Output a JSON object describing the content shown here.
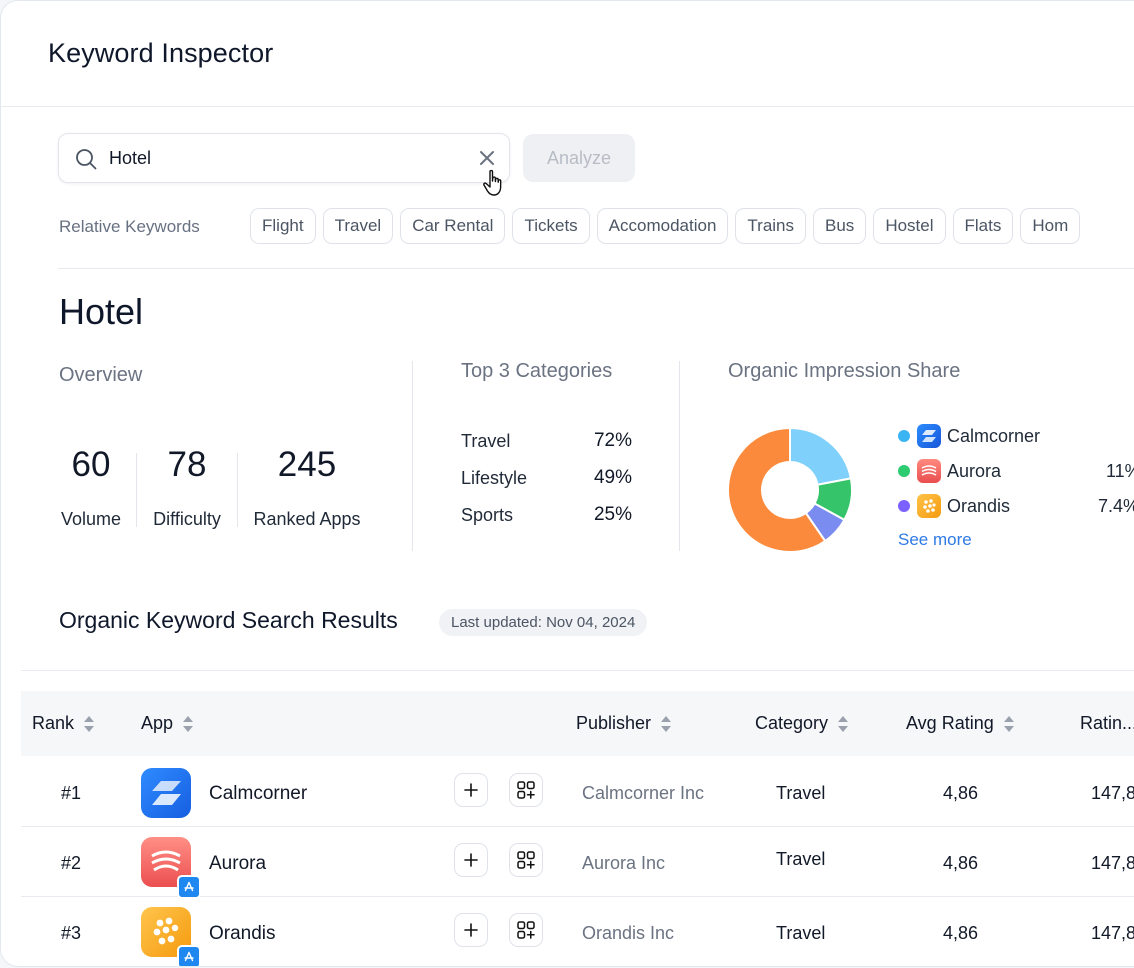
{
  "app": {
    "title": "Keyword Inspector"
  },
  "search": {
    "value": "Hotel",
    "analyze_label": "Analyze"
  },
  "relative_keywords": {
    "label": "Relative Keywords",
    "chips": [
      "Flight",
      "Travel",
      "Car Rental",
      "Tickets",
      "Accomodation",
      "Trains",
      "Bus",
      "Hostel",
      "Flats",
      "Hom"
    ]
  },
  "keyword": {
    "heading": "Hotel"
  },
  "overview": {
    "label": "Overview",
    "stats": [
      {
        "value": "60",
        "label": "Volume"
      },
      {
        "value": "78",
        "label": "Difficulty"
      },
      {
        "value": "245",
        "label": "Ranked Apps"
      }
    ]
  },
  "top_categories": {
    "label": "Top 3 Categories",
    "items": [
      {
        "name": "Travel",
        "value": "72%"
      },
      {
        "name": "Lifestyle",
        "value": "49%"
      },
      {
        "name": "Sports",
        "value": "25%"
      }
    ]
  },
  "impression_share": {
    "label": "Organic Impression Share",
    "legend": [
      {
        "name": "Calmcorner",
        "pct": "",
        "dot_color": "#3ab4f2",
        "logo": "calmcorner-logo-icon"
      },
      {
        "name": "Aurora",
        "pct": "11%",
        "dot_color": "#2ecc71",
        "logo": "aurora-logo-icon"
      },
      {
        "name": "Orandis",
        "pct": "7.4%",
        "dot_color": "#7b61ff",
        "logo": "orandis-logo-icon"
      }
    ],
    "see_more": "See more"
  },
  "chart_data": {
    "type": "pie",
    "series": [
      {
        "name": "Calmcorner",
        "value": 22,
        "color": "#7fd0fb"
      },
      {
        "name": "Aurora",
        "value": 11,
        "color": "#35c46a"
      },
      {
        "name": "Orandis",
        "value": 7.4,
        "color": "#7b8cf0"
      },
      {
        "value": 59.6,
        "color": "#fb8a3c"
      }
    ]
  },
  "results": {
    "title": "Organic Keyword Search Results",
    "updated": "Last updated: Nov 04, 2024",
    "columns": [
      "Rank",
      "App",
      "Publisher",
      "Category",
      "Avg Rating",
      "Ratin..."
    ],
    "rows": [
      {
        "rank": "#1",
        "app": "Calmcorner",
        "publisher": "Calmcorner Inc",
        "category": "Travel",
        "rating": "4,86",
        "ratings_count": "147,8"
      },
      {
        "rank": "#2",
        "app": "Aurora",
        "publisher": "Aurora Inc",
        "category": "Travel",
        "rating": "4,86",
        "ratings_count": "147,8"
      },
      {
        "rank": "#3",
        "app": "Orandis",
        "publisher": "Orandis Inc",
        "category": "Travel",
        "rating": "4,86",
        "ratings_count": "147,8"
      }
    ]
  },
  "colors": {
    "accent_link": "#2f7ae5",
    "calmcorner_brand": "#1d74f0",
    "aurora_brand": "#f26b6b",
    "orandis_brand": "#f7a823"
  }
}
